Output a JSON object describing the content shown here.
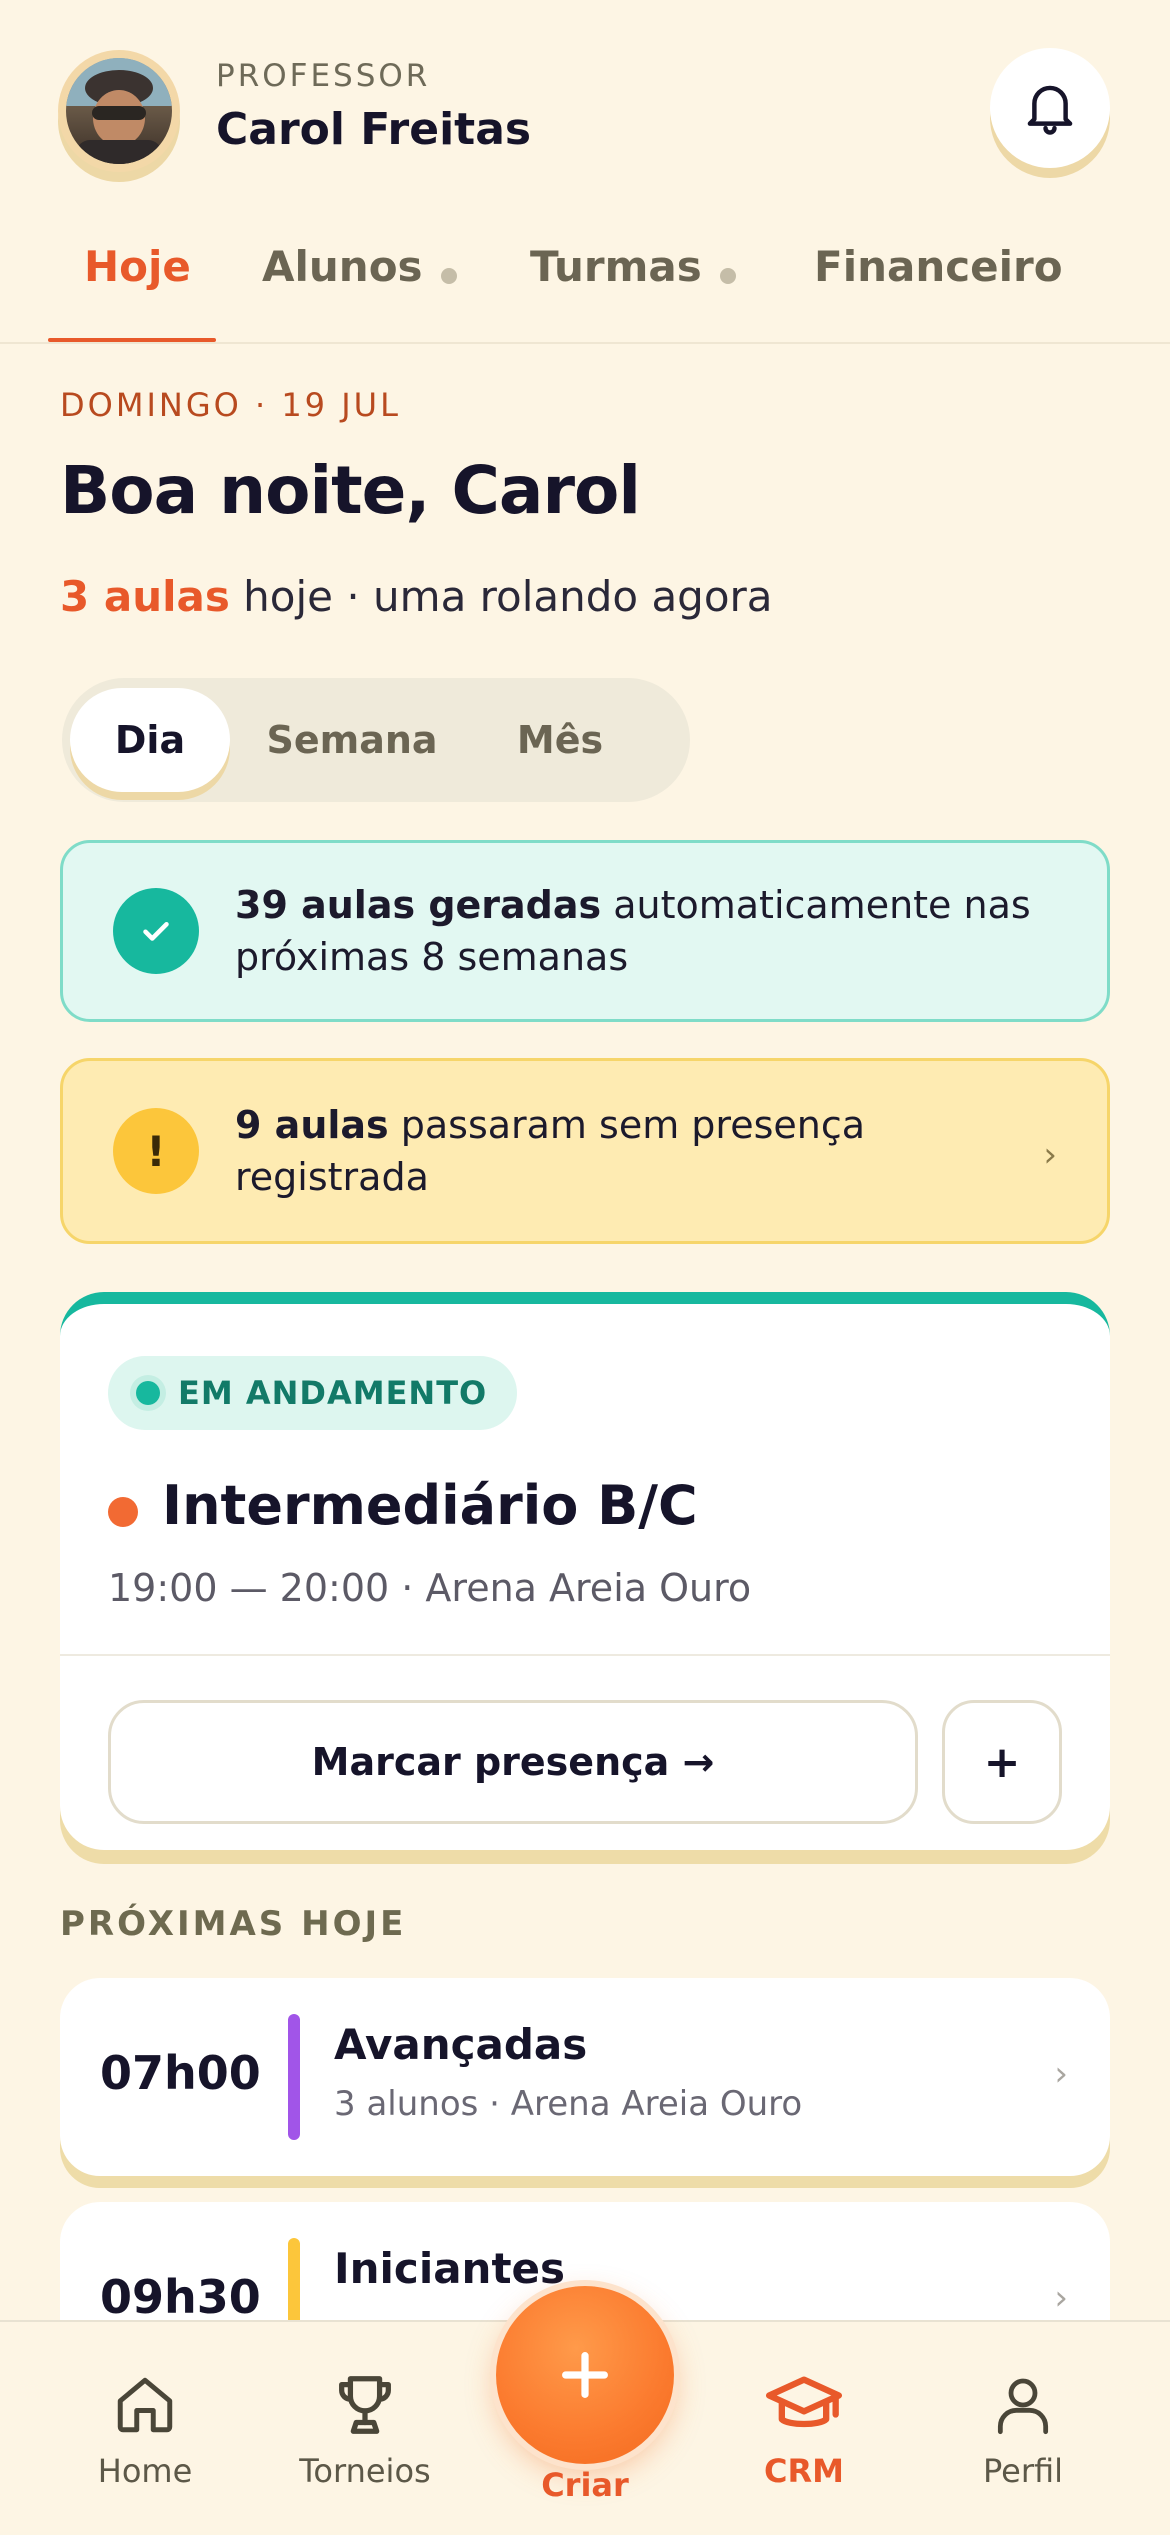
{
  "header": {
    "role_label": "PROFESSOR",
    "user_name": "Carol Freitas"
  },
  "tabs": [
    {
      "label": "Hoje",
      "active": true,
      "dot": false
    },
    {
      "label": "Alunos",
      "active": false,
      "dot": true
    },
    {
      "label": "Turmas",
      "active": false,
      "dot": true
    },
    {
      "label": "Financeiro",
      "active": false,
      "dot": false
    }
  ],
  "today": {
    "date_label": "DOMINGO · 19 JUL",
    "greeting": "Boa noite, Carol",
    "summary_highlight": "3 aulas",
    "summary_rest": " hoje · uma rolando agora"
  },
  "range_switch": {
    "options": [
      "Dia",
      "Semana",
      "Mês"
    ],
    "selected": "Dia"
  },
  "banners": {
    "success": {
      "bold": "39 aulas geradas",
      "text": " automaticamente nas próximas 8 semanas",
      "icon": "check-icon"
    },
    "warning": {
      "bold": "9 aulas",
      "text": " passaram sem presença registrada",
      "icon": "exclamation-icon",
      "chevron": "›"
    }
  },
  "live_class": {
    "badge": "EM ANDAMENTO",
    "title": "Intermediário B/C",
    "meta": "19:00 — 20:00 · Arena Areia Ouro",
    "primary_action": "Marcar presença →",
    "secondary_action": "+"
  },
  "upcoming": {
    "section_title": "PRÓXIMAS HOJE",
    "items": [
      {
        "time": "07h00",
        "title": "Avançadas",
        "meta": "3 alunos · Arena Areia Ouro",
        "color": "#A155E8",
        "chevron": "›"
      },
      {
        "time": "09h30",
        "title": "Iniciantes",
        "meta": "",
        "color": "#FCC63B",
        "chevron": "›"
      }
    ]
  },
  "bottom_nav": {
    "items": [
      {
        "label": "Home",
        "icon": "home-icon"
      },
      {
        "label": "Torneios",
        "icon": "trophy-icon"
      },
      {
        "label": "CRM",
        "icon": "graduation-cap-icon",
        "active": true
      },
      {
        "label": "Perfil",
        "icon": "person-icon"
      }
    ],
    "fab_label": "Criar",
    "fab_icon": "plus-icon"
  },
  "colors": {
    "background": "#FDF5E4",
    "accent": "#E8592A",
    "teal": "#17B89E",
    "warning": "#FCC63B"
  }
}
